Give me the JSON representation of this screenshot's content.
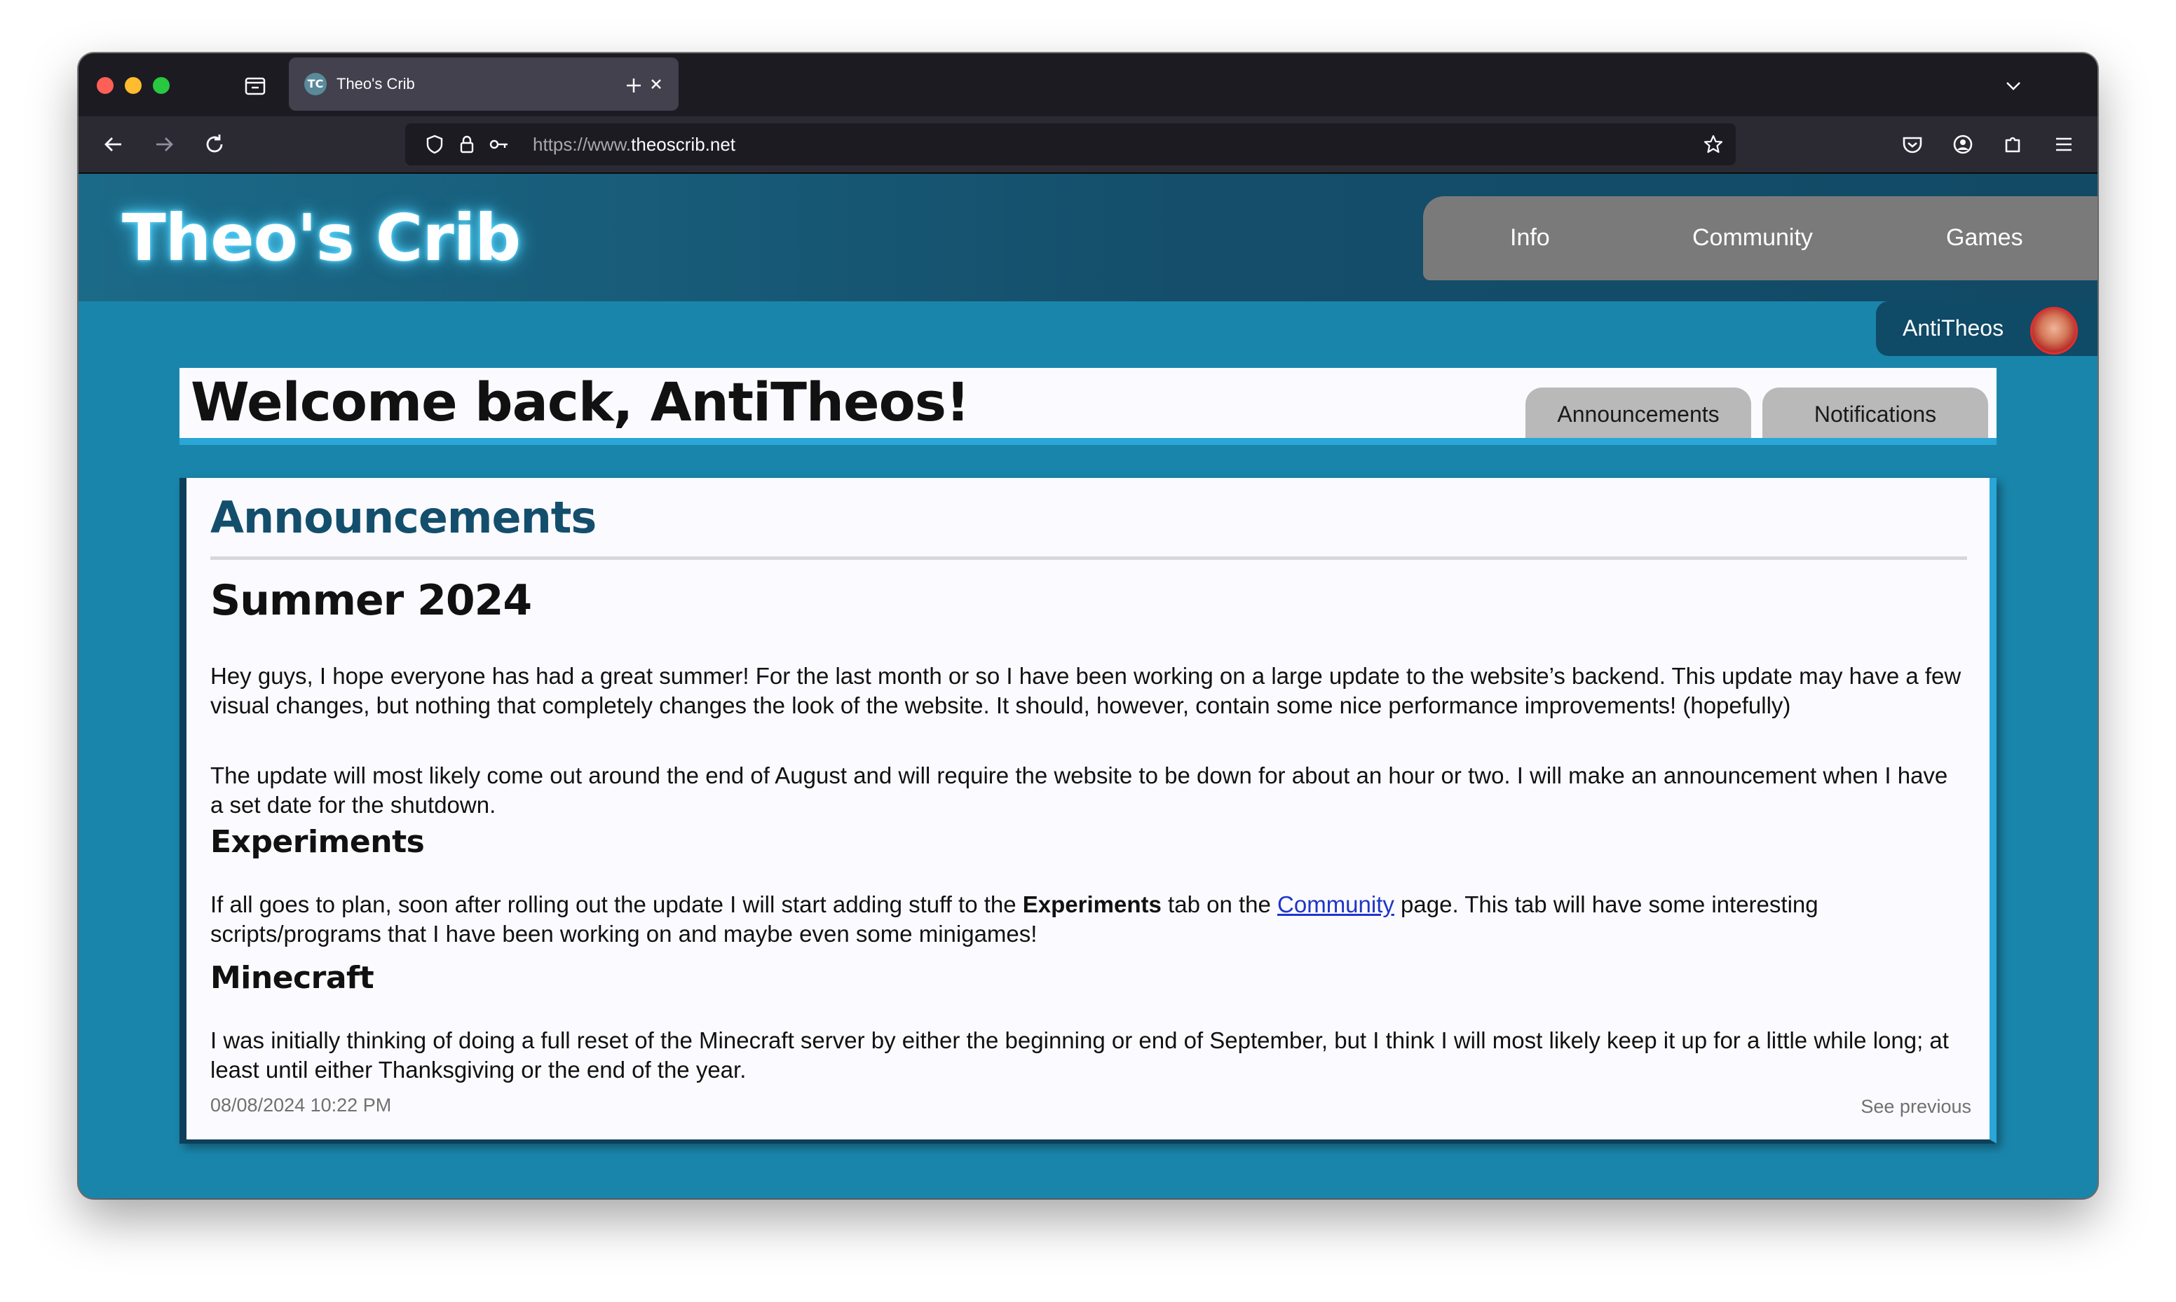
{
  "browser": {
    "tab_title": "Theo's Crib",
    "favicon_text": "TC",
    "url_prefix": "https://www.",
    "url_domain": "theoscrib.net"
  },
  "site": {
    "logo": "Theo's Crib",
    "nav": [
      "Info",
      "Community",
      "Games"
    ],
    "username": "AntiTheos"
  },
  "welcome": {
    "title": "Welcome back, AntiTheos!",
    "tabs": [
      "Announcements",
      "Notifications"
    ]
  },
  "announcements": {
    "heading": "Announcements",
    "post_title": "Summer 2024",
    "p1": "Hey guys, I hope everyone has had a great summer! For the last month or so I have been working on a large update to the website’s backend. This update may have a few visual changes, but nothing that completely changes the look of the website. It should, however, contain some nice performance improvements! (hopefully)",
    "p2": "The update will most likely come out around the end of August and will require the website to be down for about an hour or two. I will make an announcement when I have a set date for the shutdown.",
    "experiments_heading": "Experiments",
    "p3_before": "If all goes to plan, soon after rolling out the update I will start adding stuff to the ",
    "p3_bold": "Experiments",
    "p3_middle": " tab on the ",
    "p3_link": "Community",
    "p3_after": " page. This tab will have some interesting scripts/programs that I have been working on and maybe even some minigames!",
    "minecraft_heading": "Minecraft",
    "p4": "I was initially thinking of doing a full reset of the Minecraft server by either the beginning or end of September, but I think I will most likely keep it up for a little while long; at least until either Thanksgiving or the end of the year.",
    "date": "08/08/2024 10:22 PM",
    "see_previous": "See previous"
  },
  "icons": {
    "tab_overview": "tab-overview-icon",
    "close": "close-icon",
    "new_tab": "plus-icon",
    "tab_list": "chevron-down-icon",
    "back": "back-arrow-icon",
    "forward": "forward-arrow-icon",
    "reload": "reload-icon",
    "shield": "shield-icon",
    "lock": "lock-icon",
    "key": "key-icon",
    "star": "star-icon",
    "pocket": "pocket-icon",
    "account": "account-icon",
    "extensions": "puzzle-icon",
    "menu": "hamburger-menu-icon"
  },
  "colors": {
    "page_bg": "#1a85ab",
    "header_bg": "#144e6a",
    "accent": "#2aa6d7",
    "heading": "#134f6c",
    "nav_bg": "#7a7a7a"
  }
}
